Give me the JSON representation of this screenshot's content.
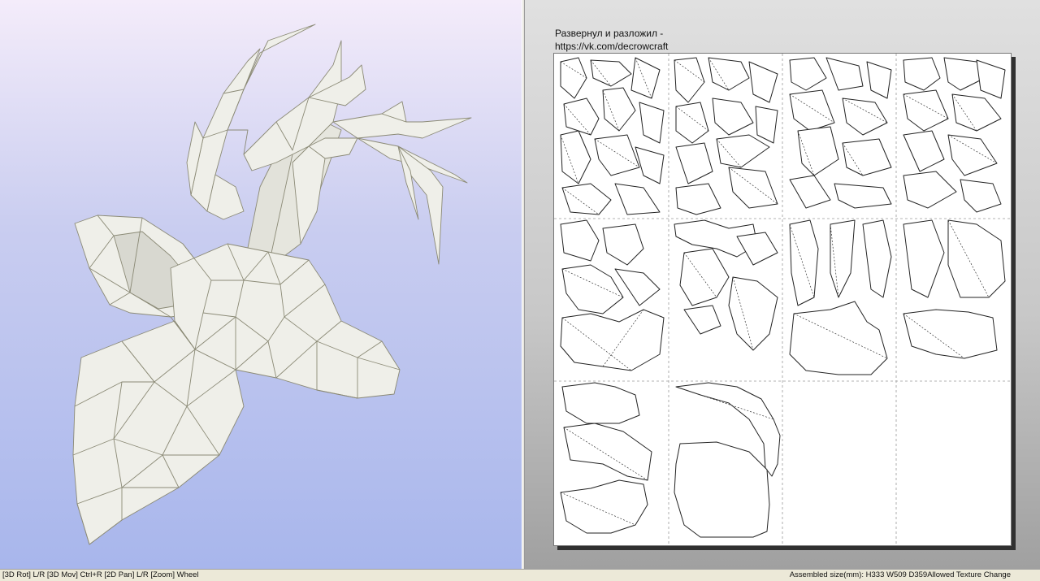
{
  "sheet": {
    "note_line1": "Развернул и разложил -",
    "note_line2": "https://vk.com/decrowcraft"
  },
  "statusbar": {
    "controls_hint": "[3D Rot] L/R [3D Mov] Ctrl+R [2D Pan] L/R [Zoom] Wheel",
    "assembled_size": "Assembled size(mm): H333 W509 D359",
    "texture_mode": "Allowed Texture Change"
  },
  "colors": {
    "view3d_top": "#f4ecfa",
    "view3d_bottom": "#a8b6ec",
    "model_face": "#efefe9",
    "model_edge": "#8b8a76",
    "page_bg": "#ffffff"
  }
}
